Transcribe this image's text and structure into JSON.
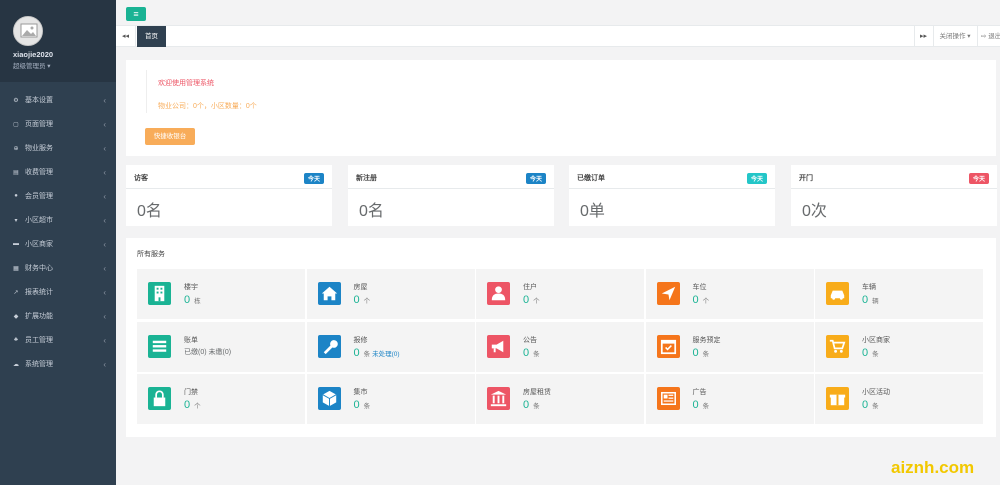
{
  "user": {
    "name": "xiaojie2020",
    "role": "超级管理员 ▾"
  },
  "sidebar": {
    "items": [
      {
        "label": "基本设置",
        "icon": "gear-icon",
        "glyph": "⚙"
      },
      {
        "label": "页面管理",
        "icon": "page-icon",
        "glyph": "▢"
      },
      {
        "label": "物业服务",
        "icon": "service-icon",
        "glyph": "⊕"
      },
      {
        "label": "收费管理",
        "icon": "charge-icon",
        "glyph": "▤"
      },
      {
        "label": "会员管理",
        "icon": "user-icon",
        "glyph": "●"
      },
      {
        "label": "小区超市",
        "icon": "cart-icon",
        "glyph": "▾"
      },
      {
        "label": "小区商家",
        "icon": "truck-icon",
        "glyph": "▬"
      },
      {
        "label": "财务中心",
        "icon": "finance-icon",
        "glyph": "▦"
      },
      {
        "label": "报表统计",
        "icon": "chart-icon",
        "glyph": "↗"
      },
      {
        "label": "扩展功能",
        "icon": "extension-icon",
        "glyph": "◆"
      },
      {
        "label": "员工管理",
        "icon": "staff-icon",
        "glyph": "♣"
      },
      {
        "label": "系统管理",
        "icon": "cloud-icon",
        "glyph": "☁"
      }
    ],
    "arrow": "‹"
  },
  "topbar": {
    "menu_glyph": "≡"
  },
  "tabs": {
    "back": "◂◂",
    "home": "首页",
    "forward": "▸▸",
    "close_ops": "关闭操作 ▾",
    "logout": "⇨ 退出"
  },
  "welcome": {
    "title": "欢迎使用管理系统",
    "info": "物业公司：0个，小区数量：0个",
    "quick_button": "快捷收银台"
  },
  "stats": [
    {
      "title": "访客",
      "badge": "今天",
      "badge_color": "#1c84c6",
      "value": "0名"
    },
    {
      "title": "新注册",
      "badge": "今天",
      "badge_color": "#1c84c6",
      "value": "0名"
    },
    {
      "title": "已缴订单",
      "badge": "今天",
      "badge_color": "#23c6c8",
      "value": "0单"
    },
    {
      "title": "开门",
      "badge": "今天",
      "badge_color": "#ed5565",
      "value": "0次"
    }
  ],
  "services": {
    "title": "所有服务",
    "items": [
      {
        "name": "楼宇",
        "num": "0",
        "unit": "栋",
        "color": "#1ab394",
        "icon": "building-icon"
      },
      {
        "name": "房屋",
        "num": "0",
        "unit": "个",
        "color": "#1c84c6",
        "icon": "house-icon"
      },
      {
        "name": "住户",
        "num": "0",
        "unit": "个",
        "color": "#ed5565",
        "icon": "resident-icon"
      },
      {
        "name": "车位",
        "num": "0",
        "unit": "个",
        "color": "#f5751b",
        "icon": "parking-icon"
      },
      {
        "name": "车辆",
        "num": "0",
        "unit": "辆",
        "color": "#f8ac1a",
        "icon": "car-icon"
      },
      {
        "name": "账单",
        "plain": "已缴(0) 未缴(0)",
        "color": "#1ab394",
        "icon": "bill-icon"
      },
      {
        "name": "报修",
        "num": "0",
        "unit": "条",
        "link": "未处理(0)",
        "color": "#1c84c6",
        "icon": "wrench-icon"
      },
      {
        "name": "公告",
        "num": "0",
        "unit": "条",
        "color": "#ed5565",
        "icon": "megaphone-icon"
      },
      {
        "name": "服务预定",
        "num": "0",
        "unit": "条",
        "color": "#f5751b",
        "icon": "calendar-icon"
      },
      {
        "name": "小区商家",
        "num": "0",
        "unit": "条",
        "color": "#f8ac1a",
        "icon": "cart-icon"
      },
      {
        "name": "门禁",
        "num": "0",
        "unit": "个",
        "color": "#1ab394",
        "icon": "lock-icon"
      },
      {
        "name": "集市",
        "num": "0",
        "unit": "条",
        "color": "#1c84c6",
        "icon": "cube-icon"
      },
      {
        "name": "房屋租赁",
        "num": "0",
        "unit": "条",
        "color": "#ed5565",
        "icon": "bank-icon"
      },
      {
        "name": "广告",
        "num": "0",
        "unit": "条",
        "color": "#f5751b",
        "icon": "newspaper-icon"
      },
      {
        "name": "小区活动",
        "num": "0",
        "unit": "条",
        "color": "#f8ac1a",
        "icon": "gift-icon"
      }
    ]
  },
  "watermark": "aiznh.com"
}
